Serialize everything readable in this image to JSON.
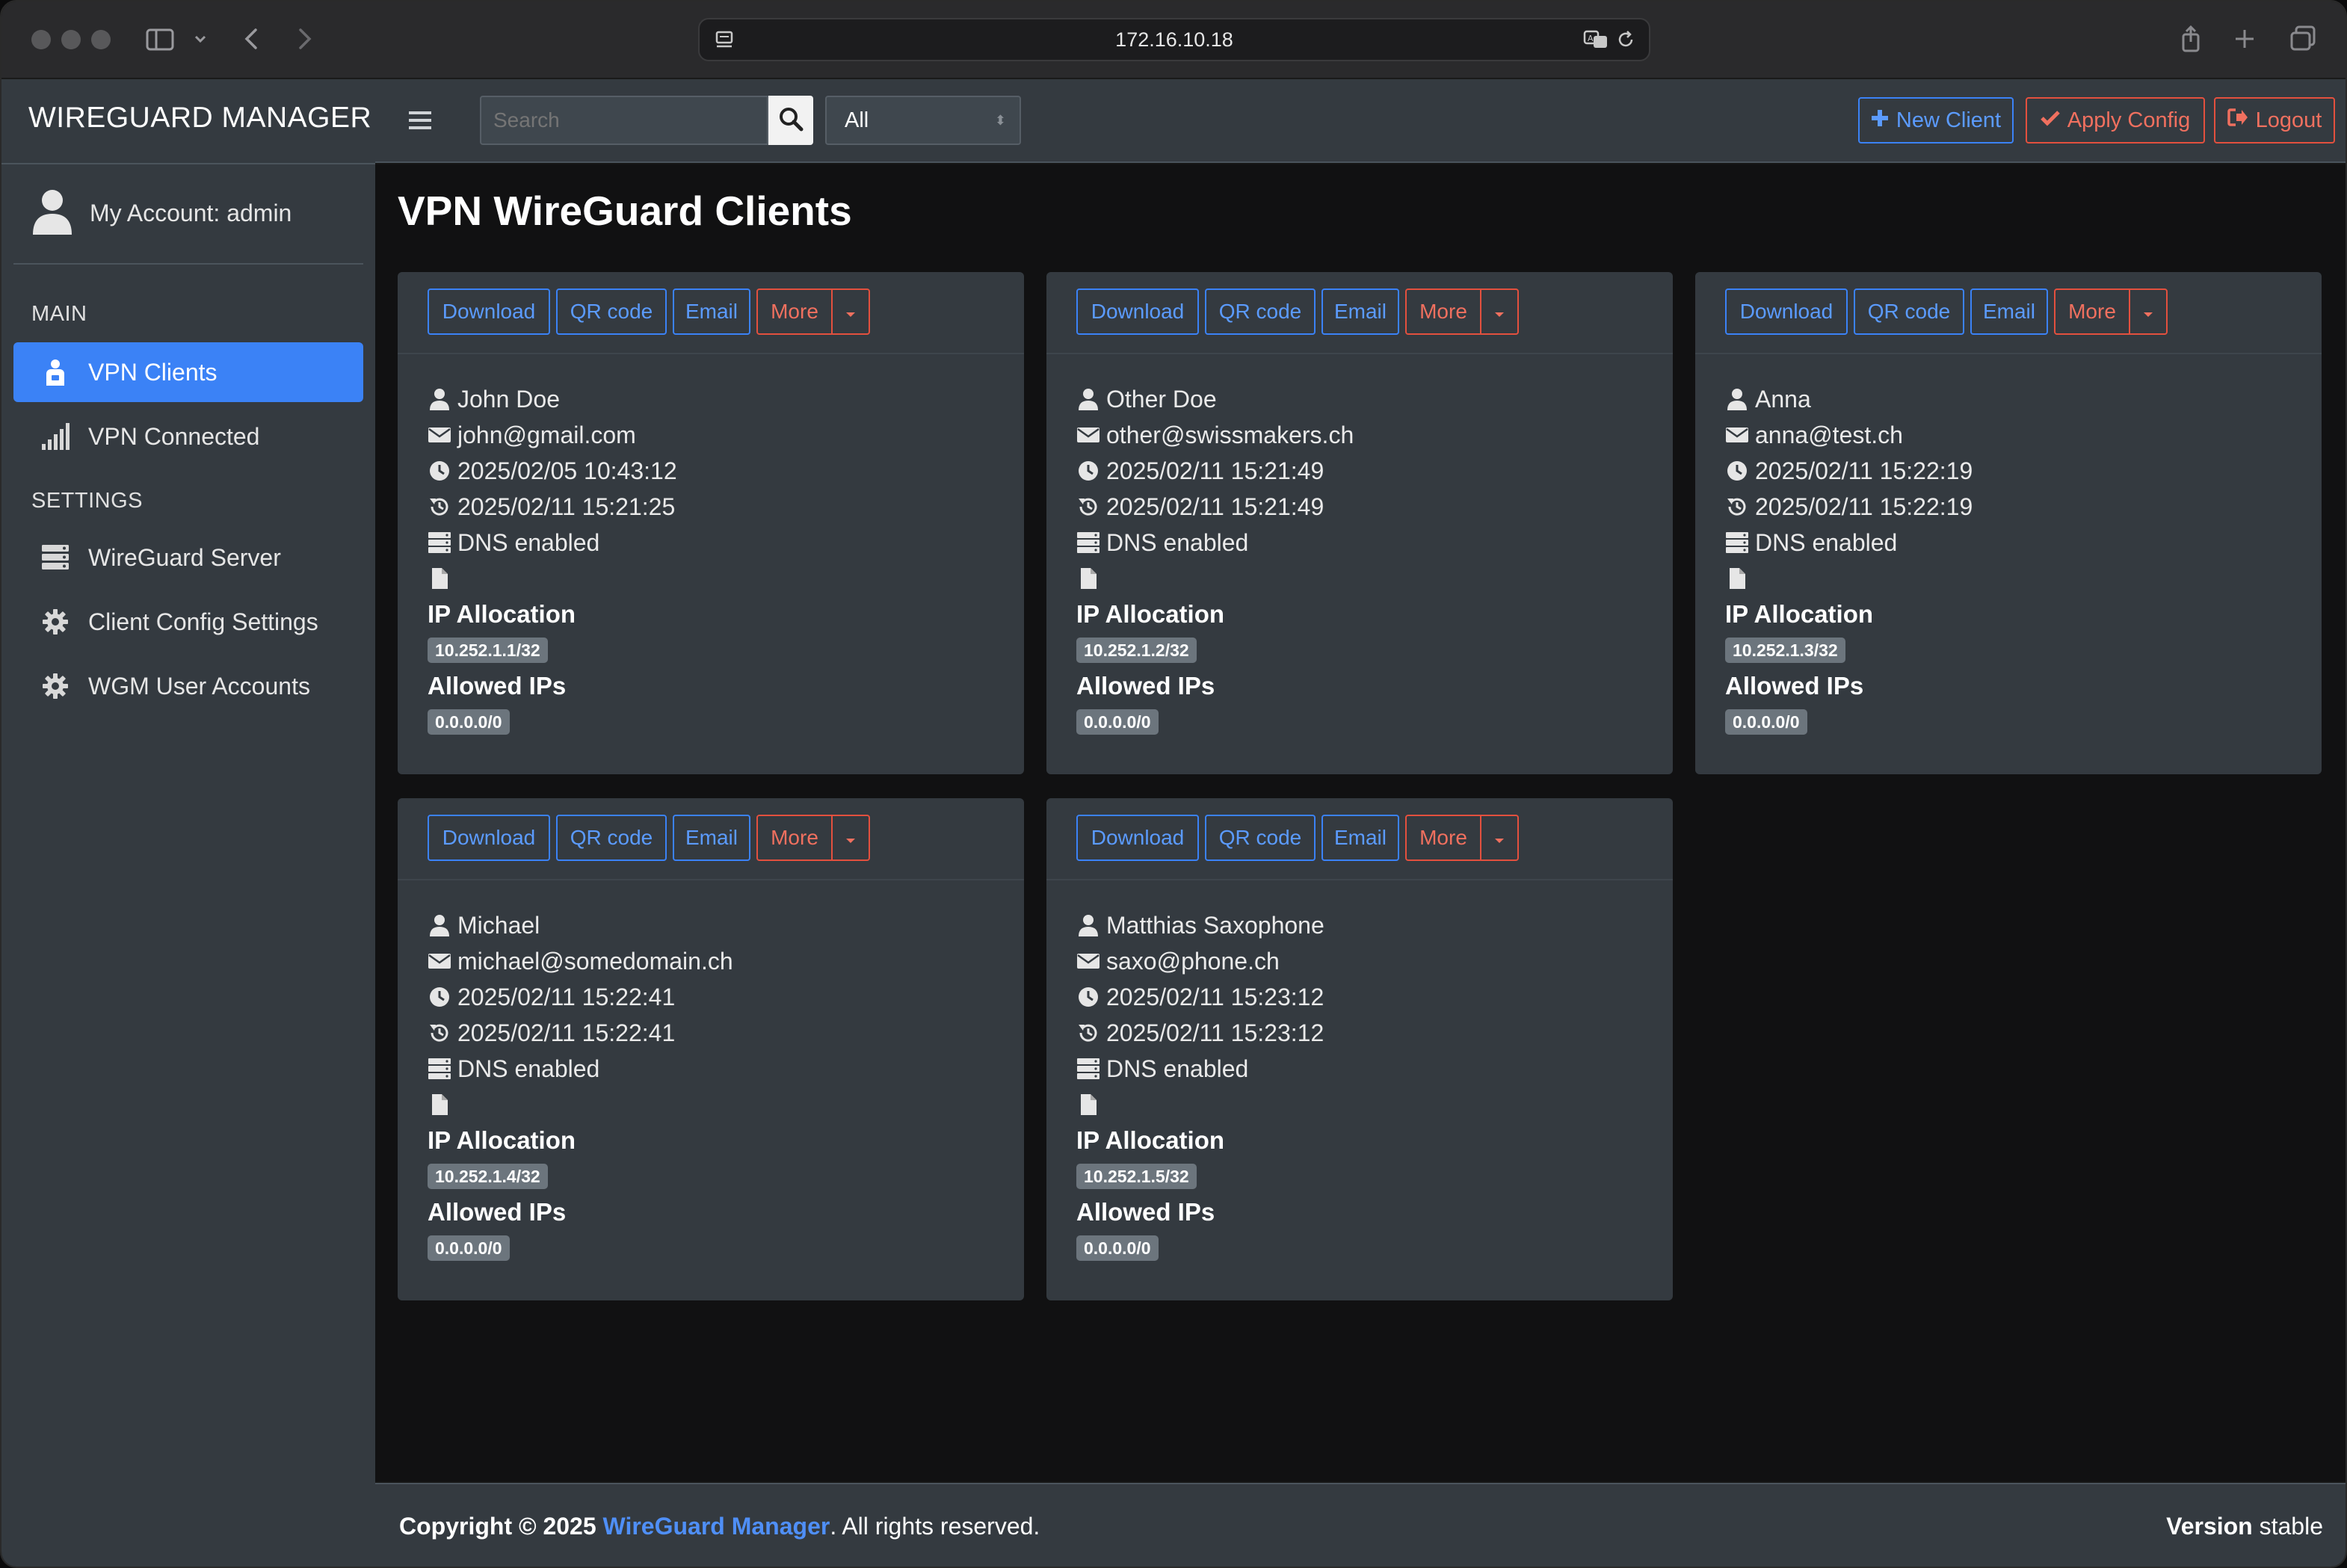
{
  "browser": {
    "url": "172.16.10.18"
  },
  "sidebar": {
    "brand": "WIREGUARD MANAGER",
    "account_label": "My Account: admin",
    "main_header": "MAIN",
    "settings_header": "SETTINGS",
    "main_items": [
      {
        "label": "VPN Clients",
        "icon": "clients-icon",
        "active": true
      },
      {
        "label": "VPN Connected",
        "icon": "signal-bars-icon",
        "active": false
      }
    ],
    "settings_items": [
      {
        "label": "WireGuard Server",
        "icon": "server-icon"
      },
      {
        "label": "Client Config Settings",
        "icon": "gear-icon"
      },
      {
        "label": "WGM User Accounts",
        "icon": "gear-icon"
      }
    ]
  },
  "topbar": {
    "search_placeholder": "Search",
    "search_value": "",
    "filter_value": "All",
    "new_client_label": "New Client",
    "apply_config_label": "Apply Config",
    "logout_label": "Logout"
  },
  "page": {
    "title": "VPN WireGuard Clients"
  },
  "card_labels": {
    "download": "Download",
    "qr_code": "QR code",
    "email": "Email",
    "more": "More",
    "ip_allocation": "IP Allocation",
    "allowed_ips": "Allowed IPs"
  },
  "clients": [
    {
      "name": "John Doe",
      "email": "john@gmail.com",
      "created": "2025/02/05 10:43:12",
      "updated": "2025/02/11 15:21:25",
      "dns": "DNS enabled",
      "ip_allocation": "10.252.1.1/32",
      "allowed_ips": "0.0.0.0/0"
    },
    {
      "name": "Other Doe",
      "email": "other@swissmakers.ch",
      "created": "2025/02/11 15:21:49",
      "updated": "2025/02/11 15:21:49",
      "dns": "DNS enabled",
      "ip_allocation": "10.252.1.2/32",
      "allowed_ips": "0.0.0.0/0"
    },
    {
      "name": "Anna",
      "email": "anna@test.ch",
      "created": "2025/02/11 15:22:19",
      "updated": "2025/02/11 15:22:19",
      "dns": "DNS enabled",
      "ip_allocation": "10.252.1.3/32",
      "allowed_ips": "0.0.0.0/0"
    },
    {
      "name": "Michael",
      "email": "michael@somedomain.ch",
      "created": "2025/02/11 15:22:41",
      "updated": "2025/02/11 15:22:41",
      "dns": "DNS enabled",
      "ip_allocation": "10.252.1.4/32",
      "allowed_ips": "0.0.0.0/0"
    },
    {
      "name": "Matthias Saxophone",
      "email": "saxo@phone.ch",
      "created": "2025/02/11 15:23:12",
      "updated": "2025/02/11 15:23:12",
      "dns": "DNS enabled",
      "ip_allocation": "10.252.1.5/32",
      "allowed_ips": "0.0.0.0/0"
    }
  ],
  "footer": {
    "copyright_prefix": "Copyright © 2025",
    "link_text": "WireGuard Manager",
    "copyright_suffix": ". All rights reserved.",
    "version_label": "Version",
    "version_value": "stable"
  },
  "colors": {
    "accent": "#3b82f6",
    "danger": "#e3503e",
    "panel": "#343a40",
    "badge": "#6c757d"
  }
}
